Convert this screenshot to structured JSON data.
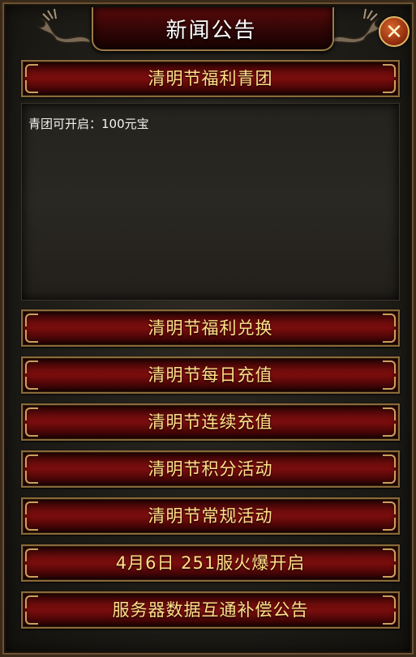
{
  "window": {
    "title": "新闻公告",
    "close_symbol": "✕"
  },
  "expanded": {
    "label": "清明节福利青团",
    "content": "青团可开启：100元宝"
  },
  "items": [
    {
      "label": "清明节福利兑换"
    },
    {
      "label": "清明节每日充值"
    },
    {
      "label": "清明节连续充值"
    },
    {
      "label": "清明节积分活动"
    },
    {
      "label": "清明节常规活动"
    },
    {
      "label": "4月6日  251服火爆开启"
    },
    {
      "label": "服务器数据互通补偿公告"
    }
  ],
  "colors": {
    "button_text": "#ffe089",
    "button_bg": "#7a0d0d",
    "border_gold": "#8b6a3a",
    "close_bg": "#d9642a"
  },
  "icons": [
    "dragon-ornament-icon",
    "close-icon"
  ]
}
